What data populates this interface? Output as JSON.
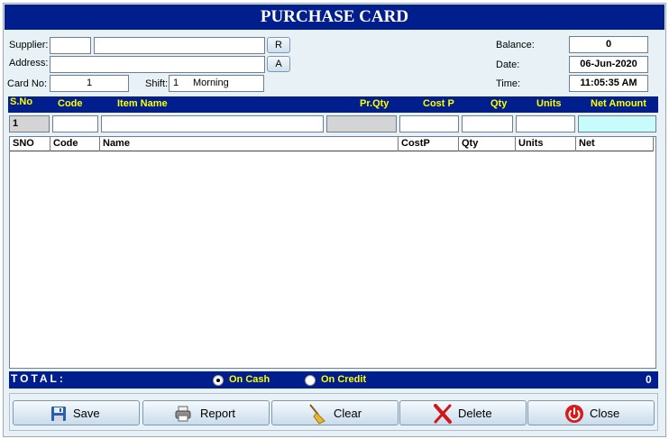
{
  "title": "PURCHASE CARD",
  "form": {
    "supplier_label": "Supplier:",
    "address_label": "Address:",
    "cardno_label": "Card No:",
    "cardno_value": "1",
    "shift_label": "Shift:",
    "shift_num": "1",
    "shift_name": "Morning",
    "r_button": "R",
    "a_button": "A",
    "balance_label": "Balance:",
    "balance_value": "0",
    "date_label": "Date:",
    "date_value": "06-Jun-2020",
    "time_label": "Time:",
    "time_value": "11:05:35 AM"
  },
  "entry_header": {
    "sno": "S.No",
    "code": "Code",
    "item_name": "Item Name",
    "prqty": "Pr.Qty",
    "costp": "Cost P",
    "qty": "Qty",
    "units": "Units",
    "net_amount": "Net Amount"
  },
  "entry_row": {
    "sno": "1"
  },
  "grid_columns": [
    "SNO",
    "Code",
    "Name",
    "CostP",
    "Qty",
    "Units",
    "Net"
  ],
  "total": {
    "label": "TOTAL:",
    "on_cash": "On Cash",
    "on_credit": "On Credit",
    "value": "0"
  },
  "buttons": {
    "save": "Save",
    "report": "Report",
    "clear": "Clear",
    "delete": "Delete",
    "close": "Close"
  },
  "colors": {
    "title_bg": "#001e8c",
    "header_text": "#ffff00",
    "panel_bg": "#e8f2f6"
  }
}
